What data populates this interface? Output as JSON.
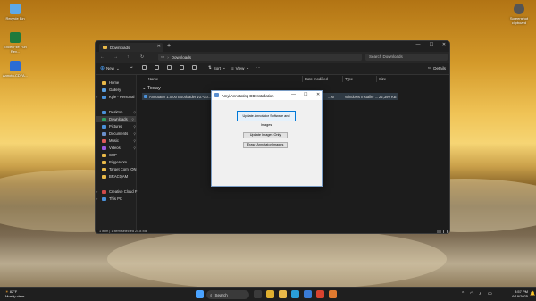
{
  "desktop_icons": [
    {
      "label": "Recycle Bin",
      "color": "#5ea9e8"
    },
    {
      "label": "Excel File Fun Rev...",
      "color": "#1f7a3c"
    },
    {
      "label": "Annoto-CDFA...",
      "color": "#2b6cd4"
    },
    {
      "label": "Screenshot clipboard",
      "color": "#555555"
    }
  ],
  "explorer": {
    "tab_label": "Downloads",
    "address": "Downloads",
    "search_placeholder": "Search Downloads",
    "commands": {
      "new": "New",
      "sort": "Sort",
      "view": "View",
      "details": "Details"
    },
    "nav": [
      {
        "label": "Home",
        "icon": "home-icon",
        "color": "#e9b949"
      },
      {
        "label": "Gallery",
        "icon": "gallery-icon",
        "color": "#5a9fe0"
      },
      {
        "label": "Kyle - Personal",
        "icon": "cloud-icon",
        "color": "#4a90d9"
      },
      {
        "label": "Desktop",
        "icon": "desktop-icon",
        "color": "#4a90d9",
        "pinned": true
      },
      {
        "label": "Downloads",
        "icon": "download-icon",
        "color": "#2e9e5f",
        "pinned": true,
        "selected": true
      },
      {
        "label": "Pictures",
        "icon": "pictures-icon",
        "color": "#4a90d9",
        "pinned": true
      },
      {
        "label": "Documents",
        "icon": "documents-icon",
        "color": "#6b8fc9",
        "pinned": true
      },
      {
        "label": "Music",
        "icon": "music-icon",
        "color": "#e05a5a",
        "pinned": true
      },
      {
        "label": "Videos",
        "icon": "videos-icon",
        "color": "#9a5ae0",
        "pinned": true
      },
      {
        "label": "CUP",
        "icon": "folder-icon",
        "color": "#e9b949"
      },
      {
        "label": "Biggercom",
        "icon": "folder-icon",
        "color": "#e9b949"
      },
      {
        "label": "Target Corn ION",
        "icon": "folder-icon",
        "color": "#e9b949"
      },
      {
        "label": "BRACQAM",
        "icon": "folder-icon",
        "color": "#e9b949"
      },
      {
        "label": "Creative Cloud F",
        "icon": "cloud-icon",
        "color": "#d04a4a"
      },
      {
        "label": "This PC",
        "icon": "pc-icon",
        "color": "#4a90d9"
      }
    ],
    "columns": [
      "Name",
      "Date modified",
      "Type",
      "Size"
    ],
    "group_label": "Today",
    "files": [
      {
        "name": "Annotator 1.0.00 Bootloader v3.-Co...",
        "date": "...M",
        "type": "Windows Installer ...",
        "size": "22,399 KB"
      }
    ],
    "status": "1 item  |  1 item selected  25.8 MB"
  },
  "dialog": {
    "title": "Amyi Annotating DB Installation",
    "buttons": [
      "Update Annotator Software and Images",
      "Update Images Only",
      "Erase Annotator Images"
    ]
  },
  "taskbar": {
    "weather_temp": "82°F",
    "weather_desc": "Mostly clear",
    "search": "Search",
    "time": "3:57 PM",
    "date": "6/19/2025",
    "apps": [
      {
        "name": "start",
        "color": "#4aa3ff"
      },
      {
        "name": "task-view",
        "color": "#bbbbbb"
      },
      {
        "name": "chrome",
        "color": "#e0b030"
      },
      {
        "name": "explorer",
        "color": "#e9b949"
      },
      {
        "name": "edge",
        "color": "#2a9fd8"
      },
      {
        "name": "mail",
        "color": "#3a7bd5"
      },
      {
        "name": "app-red",
        "color": "#d9432f"
      },
      {
        "name": "app-orange",
        "color": "#e07a2f"
      }
    ]
  }
}
